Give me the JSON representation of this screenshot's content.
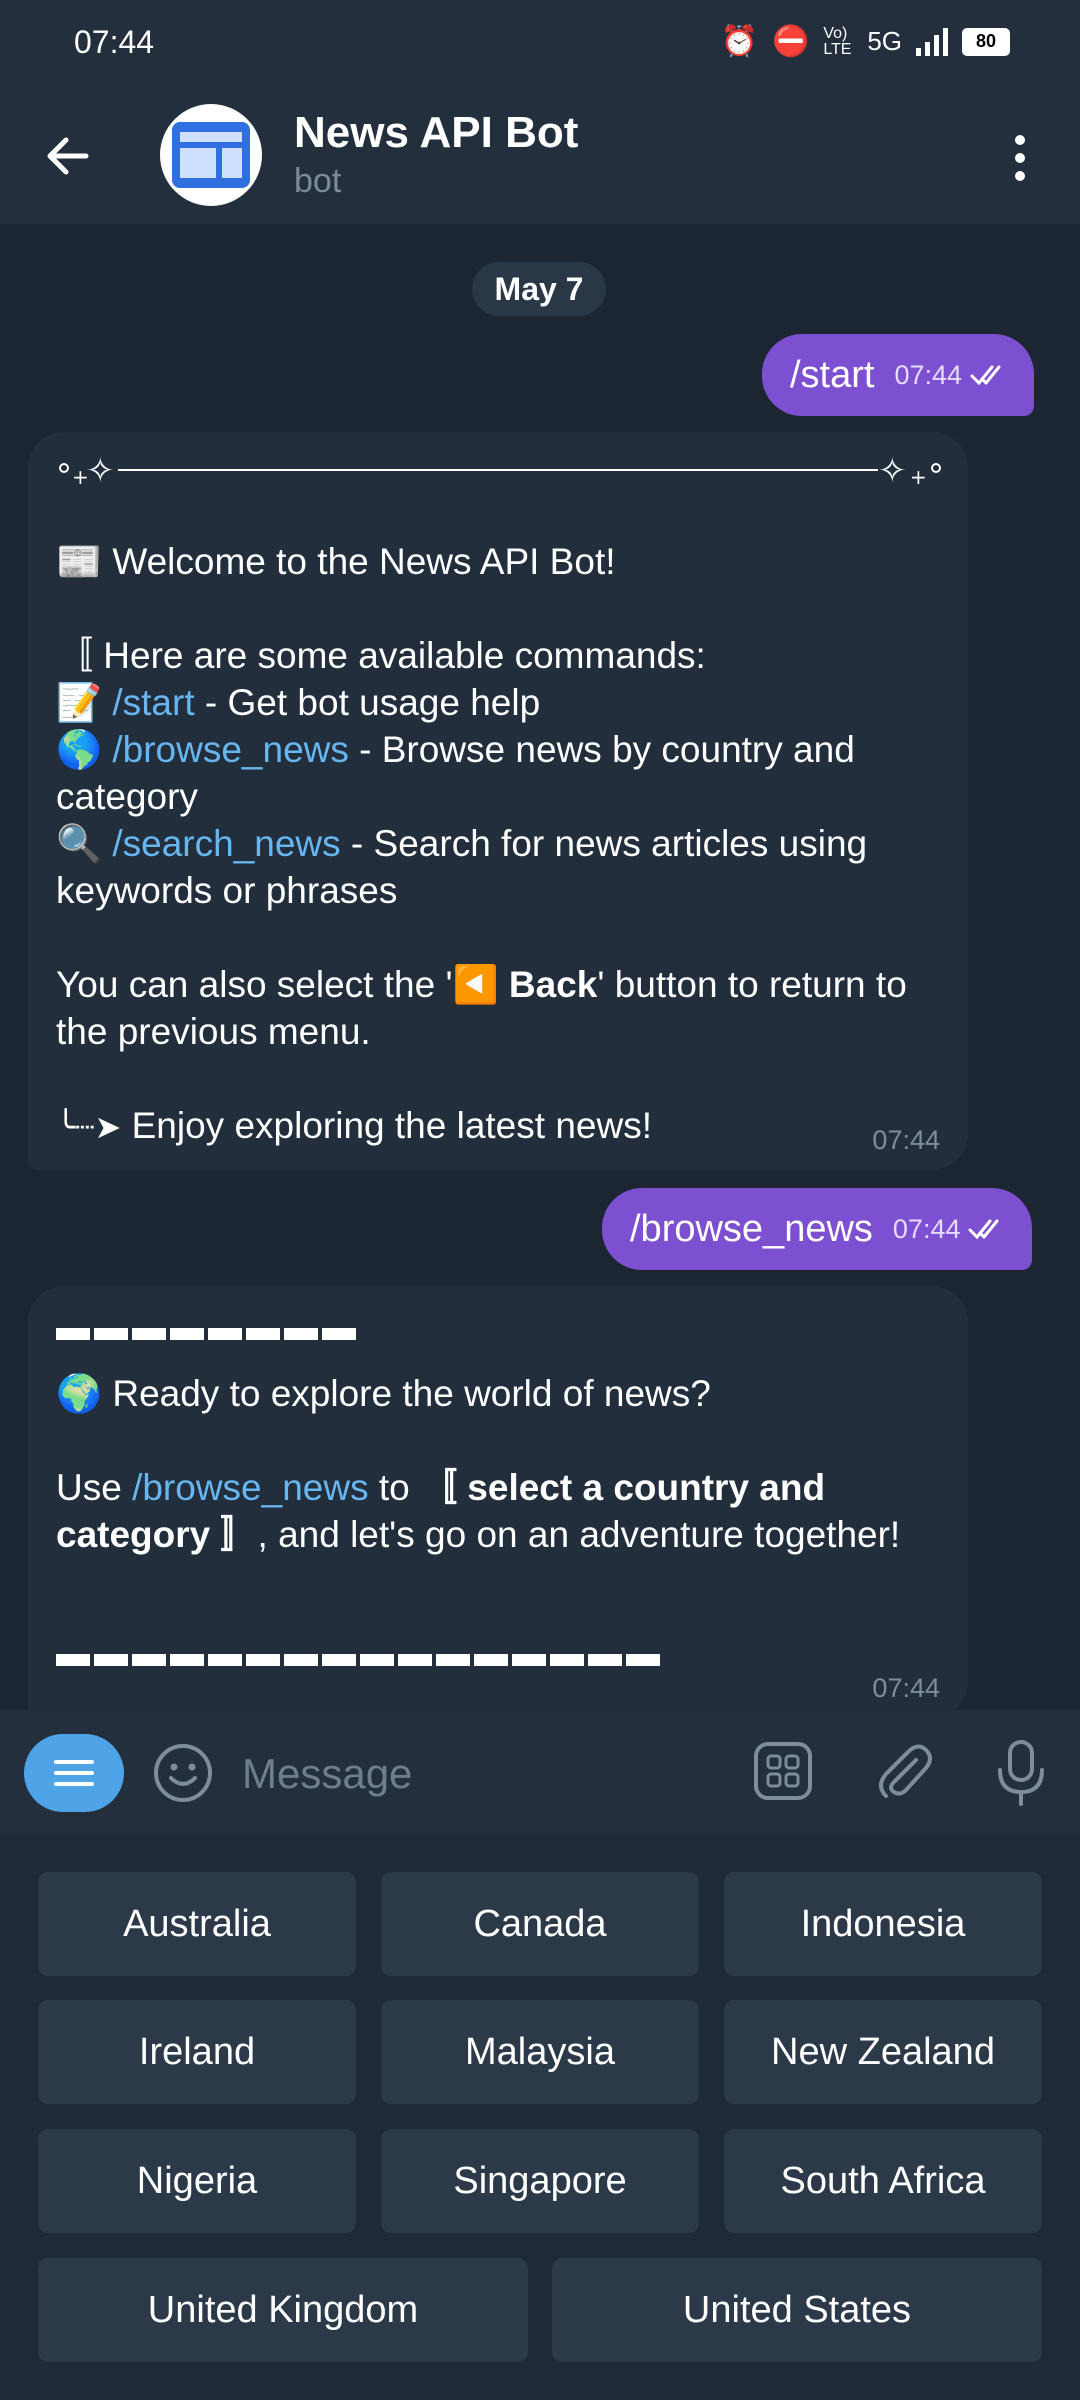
{
  "status": {
    "time": "07:44",
    "network": "5G",
    "volte": "Vo) LTE",
    "battery": "80"
  },
  "header": {
    "title": "News API Bot",
    "subtitle": "bot"
  },
  "chat": {
    "date": "May 7",
    "messages": [
      {
        "type": "out",
        "text": "/start",
        "time": "07:44"
      },
      {
        "type": "in",
        "time": "07:44",
        "welcome": "📰 Welcome to the News API Bot!",
        "intro": "〚 Here are some available commands:",
        "cmd1_icon": "📝",
        "cmd1": "/start",
        "cmd1_desc": " - Get bot usage help",
        "cmd2_icon": "🌎",
        "cmd2": "/browse_news",
        "cmd2_desc": " - Browse news by country and category",
        "cmd3_icon": "🔍",
        "cmd3": "/search_news",
        "cmd3_desc": " - Search for news articles using keywords or phrases",
        "back_pre": "You can also select the '",
        "back_icon": "◀️",
        "back_label": " Back",
        "back_post": "' button to return to the previous menu.",
        "enjoy_arrow": "╰┈➤",
        "enjoy": "Enjoy exploring the latest news!"
      },
      {
        "type": "out",
        "text": "/browse_news",
        "time": "07:44"
      },
      {
        "type": "in",
        "time": "07:44",
        "ready": "🌍 Ready to explore the world of news?",
        "use_pre": " Use ",
        "use_cmd": "/browse_news",
        "use_mid": " to ",
        "use_bold": "〚 select a country and category 〛",
        "use_post": ", and let's go on an adventure together!"
      }
    ]
  },
  "input": {
    "placeholder": "Message"
  },
  "keyboard": {
    "rows": [
      [
        "Australia",
        "Canada",
        "Indonesia"
      ],
      [
        "Ireland",
        "Malaysia",
        "New Zealand"
      ],
      [
        "Nigeria",
        "Singapore",
        "South Africa"
      ],
      [
        "United Kingdom",
        "United States"
      ]
    ]
  },
  "colors": {
    "outgoing_bubble": "#7d4fd1",
    "incoming_bubble": "#222e3c",
    "link": "#67b6ef",
    "menu_button": "#4ea4e6"
  }
}
